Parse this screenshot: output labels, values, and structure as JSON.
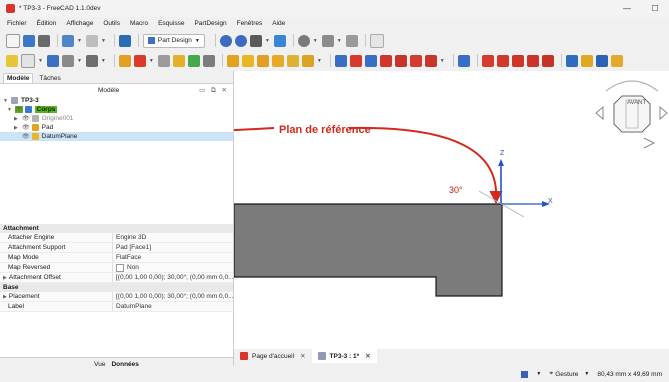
{
  "window": {
    "title": "* TP3-3 - FreeCAD 1.1.0dev",
    "minimize": "—",
    "maximize": "☐"
  },
  "menu": [
    "Fichier",
    "Édition",
    "Affichage",
    "Outils",
    "Macro",
    "Esquisse",
    "PartDesign",
    "Fenêtres",
    "Aide"
  ],
  "toolbar": {
    "workbench": "Part Design"
  },
  "panel": {
    "tabs": [
      "Modèle",
      "Tâches"
    ],
    "header": "Modèle",
    "tree": [
      {
        "label": "TP3-3",
        "level": 0
      },
      {
        "label": "Corps",
        "level": 1
      },
      {
        "label": "Origine001",
        "level": 2
      },
      {
        "label": "Pad",
        "level": 2
      },
      {
        "label": "DatumPlane",
        "level": 2
      }
    ],
    "sections": [
      {
        "name": "Attachment",
        "rows": [
          {
            "key": "Attacher Engine",
            "value": "Engine 3D"
          },
          {
            "key": "Attachment Support",
            "value": "Pad [Face1]"
          },
          {
            "key": "Map Mode",
            "value": "FlatFace"
          },
          {
            "key": "Map Reversed",
            "value": "Non"
          },
          {
            "key": "Attachment Offset",
            "value": "[(0,00 1,00 0,00); 30,00°; (0,00 mm 0,0..."
          }
        ]
      },
      {
        "name": "Base",
        "rows": [
          {
            "key": "Placement",
            "value": "[(0,00 1,00 0,00); 30,00°; (0,00 mm 0,0..."
          },
          {
            "key": "Label",
            "value": "DatumPlane"
          }
        ]
      }
    ],
    "footer_tabs": [
      "Vue",
      "Données"
    ]
  },
  "viewport": {
    "annotation": "Plan de référence",
    "angle_label": "30°",
    "axis_z": "Z",
    "axis_x": "X",
    "navcube": "AVANT",
    "annotation_color": "#d42a1c",
    "axis_color": "#2952c8",
    "solid_color": "#7a7a7a"
  },
  "doc_tabs": [
    {
      "label": "Page d'accueil",
      "active": false
    },
    {
      "label": "TP3-3 : 1*",
      "active": true
    }
  ],
  "status": {
    "nav": "Gesture",
    "dims": "80,43 mm x 49,69 mm"
  }
}
